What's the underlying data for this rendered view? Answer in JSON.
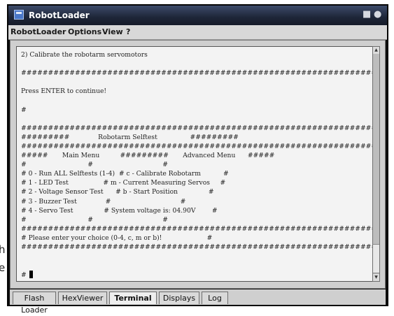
{
  "window": {
    "title": "RobotLoader"
  },
  "menu": [
    "RobotLoader",
    "Options",
    "View",
    "?"
  ],
  "background_text": [
    "h",
    "e"
  ],
  "terminal": {
    "lines": [
      "2) Calibrate the robotarm servomotors",
      "",
      "##################################################################",
      "",
      "Press ENTER to continue!",
      "",
      "#",
      "",
      "##################################################################",
      "#########              Robotarm Selftest                #########",
      "##################################################################",
      "#####       Main Menu          #########       Advanced Menu      #####",
      "#                              #                                  #",
      "# 0 - Run ALL Selftests (1-4)  # c - Calibrate Robotarm           #",
      "# 1 - LED Test                 # m - Current Measuring Servos     #",
      "# 2 - Voltage Sensor Test      # b - Start Position               #",
      "# 3 - Buzzer Test              #                                  #",
      "# 4 - Servo Test               # System voltage is: 04.90V        #",
      "#                              #                                  #",
      "##################################################################",
      "# Please enter your choice (0-4, c, m or b)!                      #",
      "##################################################################"
    ],
    "prompt": "#"
  },
  "tabs": [
    {
      "label": "Flash Loader",
      "active": false
    },
    {
      "label": "HexViewer",
      "active": false
    },
    {
      "label": "Terminal",
      "active": true
    },
    {
      "label": "Displays",
      "active": false
    },
    {
      "label": "Log",
      "active": false
    }
  ]
}
